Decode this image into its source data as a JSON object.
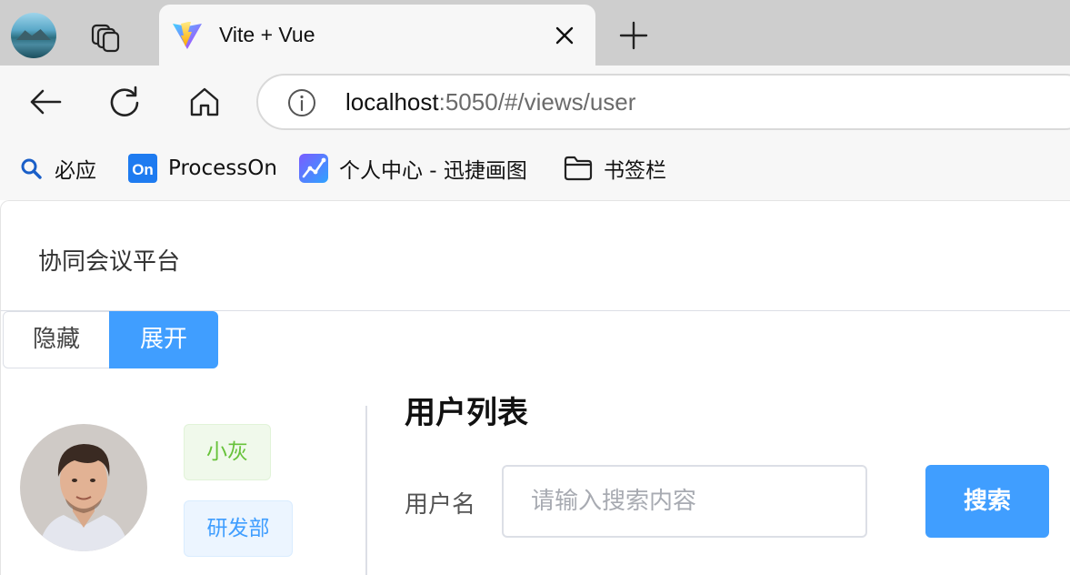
{
  "browser": {
    "tab": {
      "title": "Vite + Vue"
    },
    "address": {
      "host": "localhost",
      "rest": ":5050/#/views/user"
    },
    "bookmarks": [
      {
        "label": "必应",
        "icon": "search-icon"
      },
      {
        "label": "ProcessOn",
        "icon": "processon-icon"
      },
      {
        "label": "个人中心 - 迅捷画图",
        "icon": "xunjie-icon"
      },
      {
        "label": "书签栏",
        "icon": "folder-icon"
      }
    ],
    "colors": {
      "tabstrip": "#cecece",
      "toolbar": "#f7f7f7"
    }
  },
  "app": {
    "site_title": "协同会议平台",
    "sidebar_toggle": {
      "hide_label": "隐藏",
      "expand_label": "展开"
    },
    "user": {
      "name_tag": "小灰",
      "dept_tag": "研发部"
    },
    "main": {
      "title": "用户列表",
      "username_label": "用户名",
      "search_placeholder": "请输入搜索内容",
      "search_button": "搜索"
    },
    "colors": {
      "primary": "#409eff",
      "success": "#67c23a"
    }
  }
}
